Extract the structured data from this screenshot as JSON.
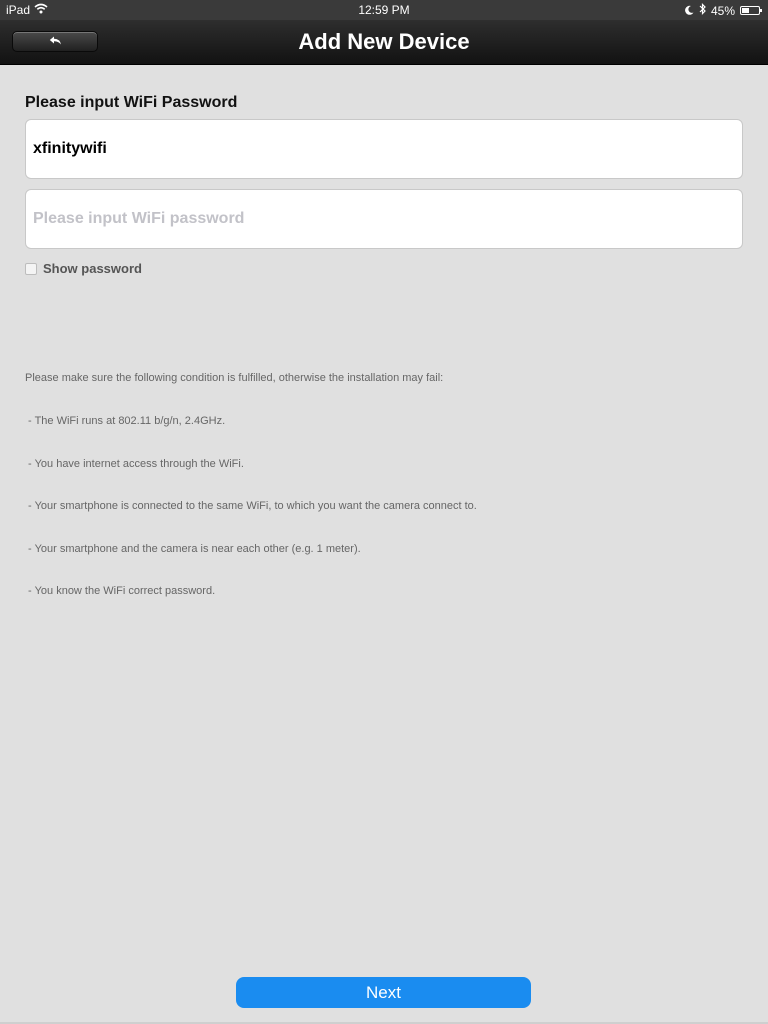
{
  "status_bar": {
    "device": "iPad",
    "time": "12:59 PM",
    "battery_percent": "45%",
    "battery_level": 0.45,
    "icons": [
      "wifi-icon",
      "moon-icon",
      "bluetooth-icon",
      "battery-icon"
    ]
  },
  "nav": {
    "title": "Add New Device",
    "back_icon": "back-arrow-icon"
  },
  "form": {
    "section_label": "Please input WiFi Password",
    "ssid_value": "xfinitywifi",
    "password_value": "",
    "password_placeholder": "Please input WiFi password",
    "show_password_label": "Show password",
    "show_password_checked": false
  },
  "info": {
    "lines": [
      "Please make sure the following condition is fulfilled, otherwise the installation may fail:",
      " - The WiFi runs at 802.11 b/g/n, 2.4GHz.",
      " - You have internet access through the WiFi.",
      " - Your smartphone is connected to the same WiFi, to which you want the camera connect to.",
      " - Your smartphone and the camera is near each other (e.g. 1 meter).",
      " - You know the WiFi correct password."
    ]
  },
  "actions": {
    "next_label": "Next"
  },
  "colors": {
    "accent": "#1a8cf0",
    "background": "#e0e0e0",
    "navbar": "#1e1e1e"
  }
}
